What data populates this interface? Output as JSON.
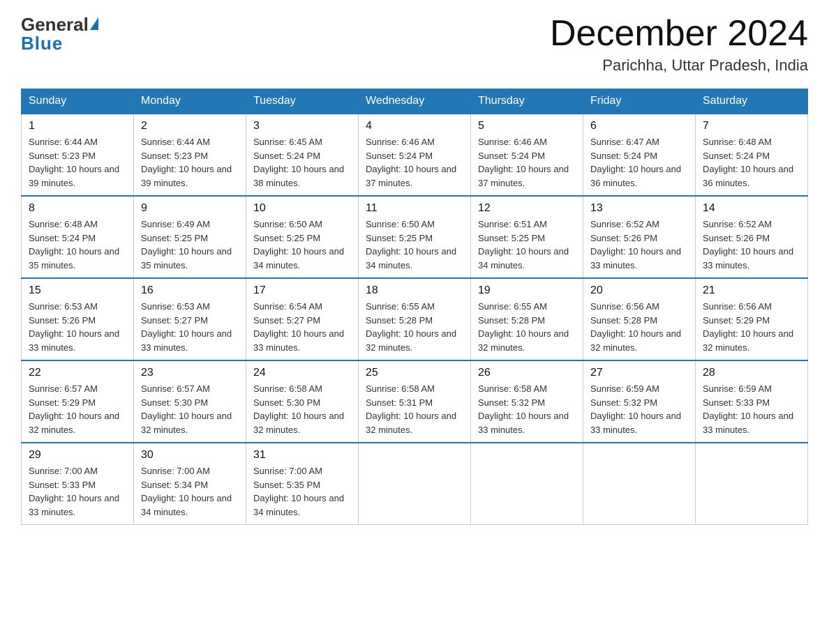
{
  "header": {
    "logo_general": "General",
    "logo_blue": "Blue",
    "month_title": "December 2024",
    "location": "Parichha, Uttar Pradesh, India"
  },
  "days_of_week": [
    "Sunday",
    "Monday",
    "Tuesday",
    "Wednesday",
    "Thursday",
    "Friday",
    "Saturday"
  ],
  "weeks": [
    [
      {
        "day": "1",
        "sunrise": "6:44 AM",
        "sunset": "5:23 PM",
        "daylight": "10 hours and 39 minutes."
      },
      {
        "day": "2",
        "sunrise": "6:44 AM",
        "sunset": "5:23 PM",
        "daylight": "10 hours and 39 minutes."
      },
      {
        "day": "3",
        "sunrise": "6:45 AM",
        "sunset": "5:24 PM",
        "daylight": "10 hours and 38 minutes."
      },
      {
        "day": "4",
        "sunrise": "6:46 AM",
        "sunset": "5:24 PM",
        "daylight": "10 hours and 37 minutes."
      },
      {
        "day": "5",
        "sunrise": "6:46 AM",
        "sunset": "5:24 PM",
        "daylight": "10 hours and 37 minutes."
      },
      {
        "day": "6",
        "sunrise": "6:47 AM",
        "sunset": "5:24 PM",
        "daylight": "10 hours and 36 minutes."
      },
      {
        "day": "7",
        "sunrise": "6:48 AM",
        "sunset": "5:24 PM",
        "daylight": "10 hours and 36 minutes."
      }
    ],
    [
      {
        "day": "8",
        "sunrise": "6:48 AM",
        "sunset": "5:24 PM",
        "daylight": "10 hours and 35 minutes."
      },
      {
        "day": "9",
        "sunrise": "6:49 AM",
        "sunset": "5:25 PM",
        "daylight": "10 hours and 35 minutes."
      },
      {
        "day": "10",
        "sunrise": "6:50 AM",
        "sunset": "5:25 PM",
        "daylight": "10 hours and 34 minutes."
      },
      {
        "day": "11",
        "sunrise": "6:50 AM",
        "sunset": "5:25 PM",
        "daylight": "10 hours and 34 minutes."
      },
      {
        "day": "12",
        "sunrise": "6:51 AM",
        "sunset": "5:25 PM",
        "daylight": "10 hours and 34 minutes."
      },
      {
        "day": "13",
        "sunrise": "6:52 AM",
        "sunset": "5:26 PM",
        "daylight": "10 hours and 33 minutes."
      },
      {
        "day": "14",
        "sunrise": "6:52 AM",
        "sunset": "5:26 PM",
        "daylight": "10 hours and 33 minutes."
      }
    ],
    [
      {
        "day": "15",
        "sunrise": "6:53 AM",
        "sunset": "5:26 PM",
        "daylight": "10 hours and 33 minutes."
      },
      {
        "day": "16",
        "sunrise": "6:53 AM",
        "sunset": "5:27 PM",
        "daylight": "10 hours and 33 minutes."
      },
      {
        "day": "17",
        "sunrise": "6:54 AM",
        "sunset": "5:27 PM",
        "daylight": "10 hours and 33 minutes."
      },
      {
        "day": "18",
        "sunrise": "6:55 AM",
        "sunset": "5:28 PM",
        "daylight": "10 hours and 32 minutes."
      },
      {
        "day": "19",
        "sunrise": "6:55 AM",
        "sunset": "5:28 PM",
        "daylight": "10 hours and 32 minutes."
      },
      {
        "day": "20",
        "sunrise": "6:56 AM",
        "sunset": "5:28 PM",
        "daylight": "10 hours and 32 minutes."
      },
      {
        "day": "21",
        "sunrise": "6:56 AM",
        "sunset": "5:29 PM",
        "daylight": "10 hours and 32 minutes."
      }
    ],
    [
      {
        "day": "22",
        "sunrise": "6:57 AM",
        "sunset": "5:29 PM",
        "daylight": "10 hours and 32 minutes."
      },
      {
        "day": "23",
        "sunrise": "6:57 AM",
        "sunset": "5:30 PM",
        "daylight": "10 hours and 32 minutes."
      },
      {
        "day": "24",
        "sunrise": "6:58 AM",
        "sunset": "5:30 PM",
        "daylight": "10 hours and 32 minutes."
      },
      {
        "day": "25",
        "sunrise": "6:58 AM",
        "sunset": "5:31 PM",
        "daylight": "10 hours and 32 minutes."
      },
      {
        "day": "26",
        "sunrise": "6:58 AM",
        "sunset": "5:32 PM",
        "daylight": "10 hours and 33 minutes."
      },
      {
        "day": "27",
        "sunrise": "6:59 AM",
        "sunset": "5:32 PM",
        "daylight": "10 hours and 33 minutes."
      },
      {
        "day": "28",
        "sunrise": "6:59 AM",
        "sunset": "5:33 PM",
        "daylight": "10 hours and 33 minutes."
      }
    ],
    [
      {
        "day": "29",
        "sunrise": "7:00 AM",
        "sunset": "5:33 PM",
        "daylight": "10 hours and 33 minutes."
      },
      {
        "day": "30",
        "sunrise": "7:00 AM",
        "sunset": "5:34 PM",
        "daylight": "10 hours and 34 minutes."
      },
      {
        "day": "31",
        "sunrise": "7:00 AM",
        "sunset": "5:35 PM",
        "daylight": "10 hours and 34 minutes."
      },
      null,
      null,
      null,
      null
    ]
  ]
}
